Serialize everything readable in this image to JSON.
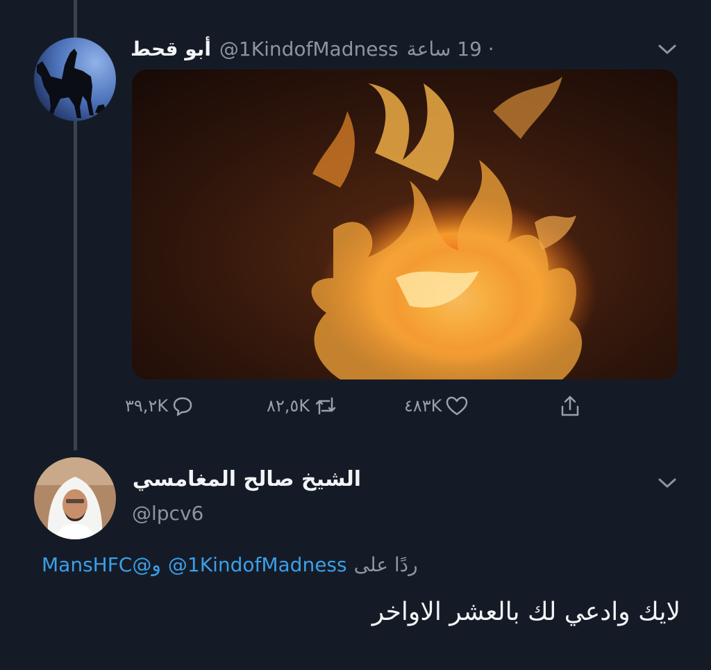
{
  "tweet": {
    "author_name": "أبو قحط",
    "author_handle": "@1KindofMadness",
    "time": "· 19 ساعة",
    "replies": "٣٩,٢K",
    "retweets": "٨٢,٥K",
    "likes": "٤٨٣K"
  },
  "reply": {
    "author_name": "الشيخ صالح المغامسي",
    "author_handle": "@lpcv6",
    "replying_to_label": "ردًا على",
    "mention_1": "@1KindofMadness",
    "mention_2": "و@MansHFC",
    "text": "لايك وادعي لك بالعشر الاواخر"
  },
  "colors": {
    "background": "#151b26",
    "mention": "#3aa0ea",
    "secondary_text": "#8b96a3"
  },
  "icons": [
    "chevron-down-icon",
    "reply-icon",
    "retweet-icon",
    "like-icon",
    "share-icon"
  ]
}
